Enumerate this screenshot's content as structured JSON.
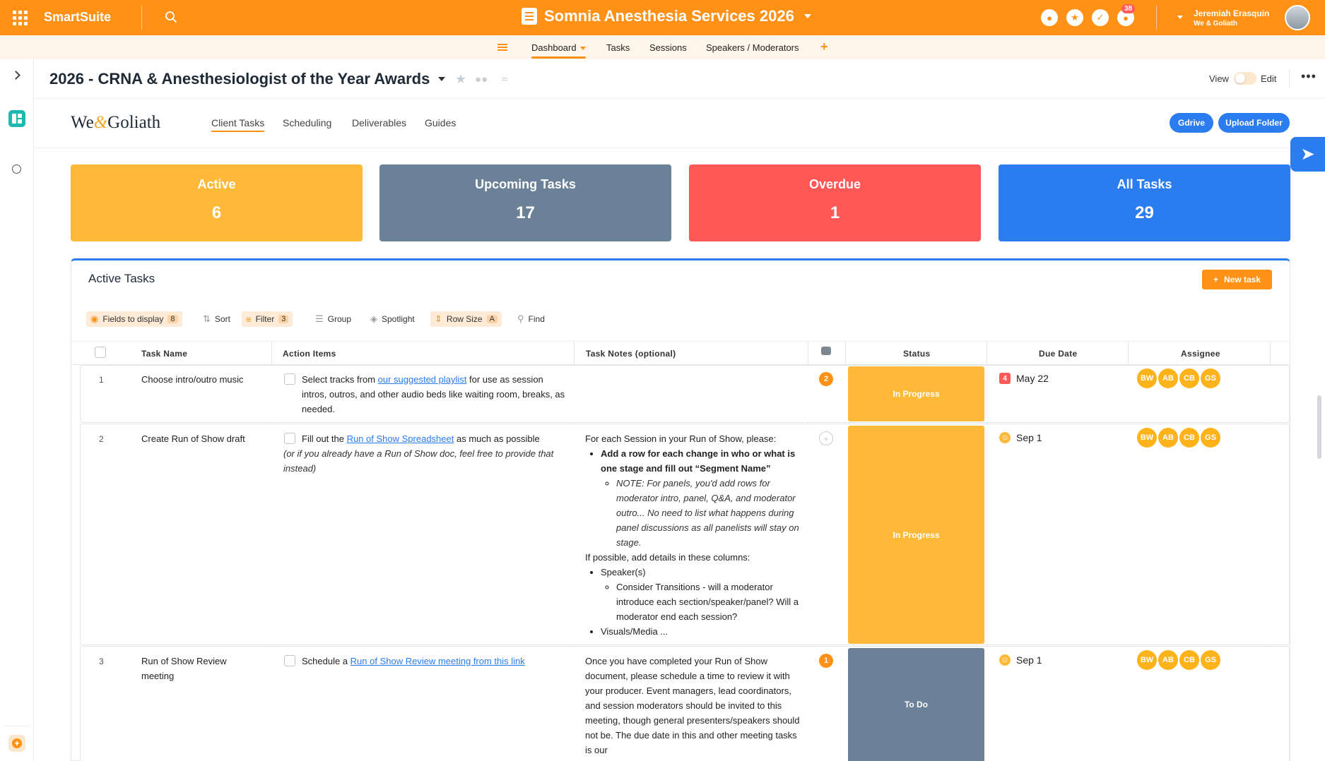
{
  "app": {
    "brand": "SmartSuite",
    "workspace_title": "Somnia Anesthesia Services 2026",
    "notification_count": "38",
    "user_name": "Jeremiah Erasquin",
    "user_org": "We & Goliath"
  },
  "nav": {
    "items": [
      {
        "label": "Dashboard"
      },
      {
        "label": "Tasks"
      },
      {
        "label": "Sessions"
      },
      {
        "label": "Speakers / Moderators"
      }
    ],
    "add": "+"
  },
  "page": {
    "title": "2026 - CRNA & Anesthesiologist of the Year Awards",
    "view_label": "View",
    "edit_label": "Edit"
  },
  "dashboard": {
    "logo_left": "We",
    "logo_amp": "&",
    "logo_right": "Goliath",
    "tabs": [
      {
        "label": "Client Tasks"
      },
      {
        "label": "Scheduling"
      },
      {
        "label": "Deliverables"
      },
      {
        "label": "Guides"
      }
    ],
    "buttons": {
      "gdrive": "Gdrive",
      "upload": "Upload Folder"
    },
    "stats": [
      {
        "label": "Active",
        "value": "6",
        "color": "#ffb938"
      },
      {
        "label": "Upcoming Tasks",
        "value": "17",
        "color": "#6a8198"
      },
      {
        "label": "Overdue",
        "value": "1",
        "color": "#ff5656"
      },
      {
        "label": "All Tasks",
        "value": "29",
        "color": "#2b7cef"
      }
    ]
  },
  "panel": {
    "title": "Active Tasks",
    "new_task": "New task",
    "toolbar": {
      "fields": "Fields to display",
      "fields_count": "8",
      "sort": "Sort",
      "filter": "Filter",
      "filter_count": "3",
      "group": "Group",
      "spotlight": "Spotlight",
      "row_size": "Row Size",
      "row_size_value": "A",
      "find": "Find"
    },
    "columns": {
      "task_name": "Task Name",
      "action_items": "Action Items",
      "task_notes": "Task Notes (optional)",
      "status": "Status",
      "due_date": "Due Date",
      "assignee": "Assignee"
    },
    "rows": [
      {
        "num": "1",
        "name": "Choose intro/outro music",
        "action_pre": "Select tracks from ",
        "action_link": "our suggested playlist",
        "action_post": " for use as session intros, outros, and other audio beds like waiting room, breaks, as needed.",
        "comments": "2",
        "status": "In Progress",
        "status_color": "#ffb938",
        "due_badge": "4",
        "due": "May 22",
        "assignees": [
          "BW",
          "AB",
          "CB",
          "GS"
        ]
      },
      {
        "num": "2",
        "name": "Create Run of Show draft",
        "action_pre": "Fill out the ",
        "action_link": "Run of Show Spreadsheet",
        "action_post": " as much as possible",
        "action_italic": "(or if you already have a Run of Show doc, feel free to provide that instead)",
        "notes_intro": "For each Session in your Run of Show, please:",
        "notes_b1": "Add a row for each change in who or what is one stage and fill out “Segment Name”",
        "notes_b1_sub": "NOTE: For panels, you'd add rows for moderator intro, panel, Q&A, and moderator outro... No need to list what happens during panel discussions as all panelists will stay on stage.",
        "notes_mid": "If possible, add details in these columns:",
        "notes_b2": "Speaker(s)",
        "notes_b2_sub": "Consider Transitions - will a moderator introduce each section/speaker/panel? Will a moderator end each session?",
        "notes_b3": "Visuals/Media ...",
        "status": "In Progress",
        "status_color": "#ffb938",
        "due": "Sep 1",
        "assignees": [
          "BW",
          "AB",
          "CB",
          "GS"
        ]
      },
      {
        "num": "3",
        "name": "Run of Show Review meeting",
        "action_pre": "Schedule a ",
        "action_link": "Run of Show Review meeting from this link",
        "notes": "Once you have completed your Run of Show document, please schedule a time to review it with your producer. Event managers, lead coordinators, and session moderators should be invited to this meeting, though general presenters/speakers should not be. The due date in this and other meeting tasks is our",
        "comments": "1",
        "status": "To Do",
        "status_color": "#6a8198",
        "due": "Sep 1",
        "assignees": [
          "BW",
          "AB",
          "CB",
          "GS"
        ]
      }
    ]
  }
}
